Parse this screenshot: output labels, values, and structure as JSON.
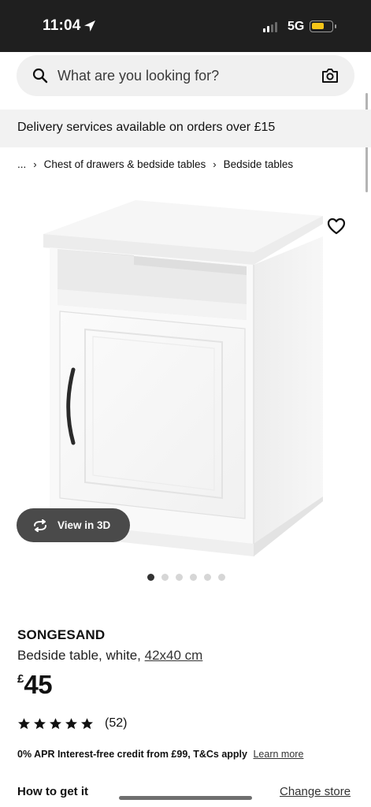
{
  "status_bar": {
    "time": "11:04",
    "network": "5G",
    "battery_color": "#f5c518"
  },
  "search": {
    "placeholder": "What are you looking for?",
    "icon": "search-icon",
    "camera_icon": "camera-icon"
  },
  "delivery_banner": {
    "text": "Delivery services available on orders over £15"
  },
  "breadcrumb": {
    "ellipsis": "...",
    "items": [
      "Chest of drawers & bedside tables",
      "Bedside tables"
    ]
  },
  "product_image": {
    "view_3d_label": "View in 3D",
    "image_count": 6,
    "active_index": 0
  },
  "product": {
    "name": "SONGESAND",
    "description": "Bedside table, white,",
    "size": "42x40 cm",
    "currency": "£",
    "price": "45",
    "rating_stars": 5,
    "review_count": "(52)"
  },
  "credit": {
    "text": "0% APR Interest-free credit from £99, T&Cs apply",
    "link": "Learn more"
  },
  "delivery_section": {
    "heading": "How to get it",
    "change_store": "Change store"
  },
  "colors": {
    "status_bar_bg": "#1f1f1f",
    "search_bg": "#f0f0f0",
    "banner_bg": "#f2f2f2",
    "view3d_bg": "#4a4a4a"
  }
}
